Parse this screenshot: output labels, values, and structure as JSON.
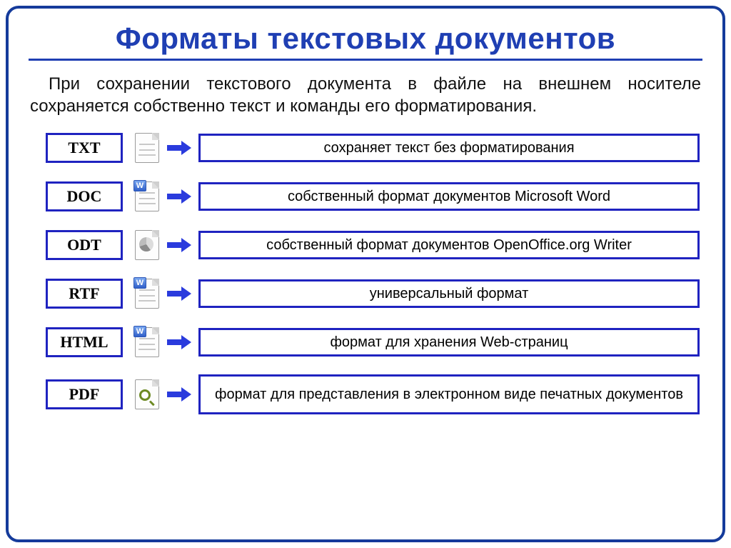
{
  "title": "Форматы текстовых документов",
  "intro": "При сохранении текстового документа в файле на внешнем носителе сохраняется собственно текст и команды его форматирования.",
  "rows": [
    {
      "format": "TXT",
      "icon": "txt-icon",
      "desc": "сохраняет текст без форматирования"
    },
    {
      "format": "DOC",
      "icon": "doc-icon",
      "desc": "собственный формат документов Microsoft Word"
    },
    {
      "format": "ODT",
      "icon": "odt-icon",
      "desc": "собственный формат документов OpenOffice.org Writer"
    },
    {
      "format": "RTF",
      "icon": "rtf-icon",
      "desc": "универсальный формат"
    },
    {
      "format": "HTML",
      "icon": "html-icon",
      "desc": "формат для хранения Web-страниц"
    },
    {
      "format": "PDF",
      "icon": "pdf-icon",
      "desc": "формат для представления в электронном виде печатных документов"
    }
  ]
}
